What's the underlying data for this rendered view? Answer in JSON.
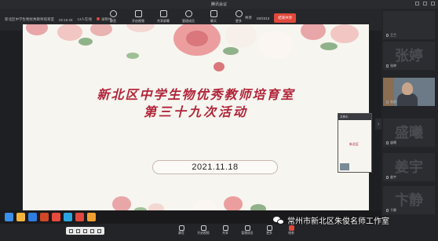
{
  "window": {
    "title": "腾讯会议"
  },
  "toolbar": {
    "meeting_name": "新北区中学生物优秀教师培育室",
    "timer": "02:15:28",
    "members": "13人在线",
    "recording": "录制中",
    "tools": [
      {
        "label": "静音",
        "icon": "microphone-icon"
      },
      {
        "label": "开启视频",
        "icon": "camera-icon"
      },
      {
        "label": "共享屏幕",
        "icon": "share-screen-icon"
      },
      {
        "label": "管理成员",
        "icon": "members-icon"
      },
      {
        "label": "聊天",
        "icon": "chat-icon"
      },
      {
        "label": "更多",
        "icon": "more-icon"
      }
    ],
    "right_label": "共享",
    "page": "02/2313",
    "leave_label": "结束共享"
  },
  "slide": {
    "title_line1": "新北区中学生物优秀教师培育室",
    "title_line2": "第三十九次活动",
    "date": "2021.11.18",
    "accent_color": "#b0253a"
  },
  "preview": {
    "header": "共享中",
    "text": "新北区"
  },
  "participants": [
    {
      "display": "",
      "name": "王兰"
    },
    {
      "display": "张婷",
      "name": "张婷"
    },
    {
      "display": "",
      "name": "朱俊",
      "video": true
    },
    {
      "display": "盛曦",
      "name": "盛曦"
    },
    {
      "display": "姜宇",
      "name": "姜宇"
    },
    {
      "display": "卞静",
      "name": "卞静"
    }
  ],
  "footer": {
    "tools": [
      {
        "label": "静音",
        "icon": "microphone-icon"
      },
      {
        "label": "开启视频",
        "icon": "camera-icon"
      },
      {
        "label": "共享",
        "icon": "share-icon"
      },
      {
        "label": "管理成员",
        "icon": "members-icon"
      },
      {
        "label": "更多",
        "icon": "more-icon"
      },
      {
        "label": "结束",
        "icon": "end-icon"
      }
    ]
  },
  "watermark": {
    "text": "常州市新北区朱俊名师工作室"
  }
}
